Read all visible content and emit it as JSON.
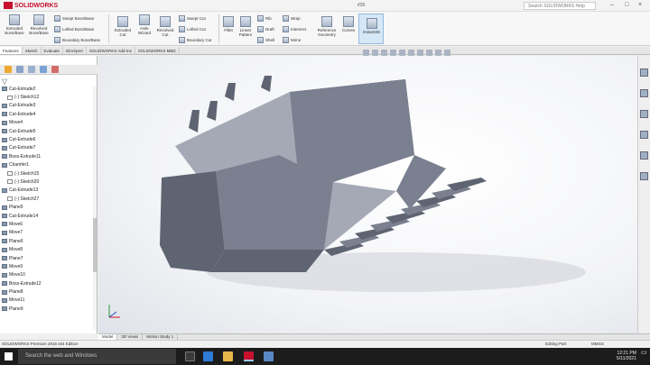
{
  "app": {
    "brand": "SOLIDWORKS",
    "title": "#20",
    "search_placeholder": "Search SOLIDWORKS Help"
  },
  "ribbon": {
    "buttons": [
      {
        "label": "Extruded Boss/Base"
      },
      {
        "label": "Revolved Boss/Base"
      },
      {
        "label": "Extruded Cut"
      },
      {
        "label": "Hole Wizard"
      },
      {
        "label": "Revolved Cut"
      },
      {
        "label": "Fillet"
      },
      {
        "label": "Linear Pattern"
      },
      {
        "label": "Reference Geometry"
      },
      {
        "label": "Curves"
      },
      {
        "label": "Instant3D"
      }
    ],
    "small": [
      {
        "label": "Swept Boss/Base"
      },
      {
        "label": "Lofted Boss/Base"
      },
      {
        "label": "Boundary Boss/Base"
      },
      {
        "label": "Swept Cut"
      },
      {
        "label": "Lofted Cut"
      },
      {
        "label": "Boundary Cut"
      },
      {
        "label": "Rib"
      },
      {
        "label": "Draft"
      },
      {
        "label": "Shell"
      },
      {
        "label": "Wrap"
      },
      {
        "label": "Intersect"
      },
      {
        "label": "Mirror"
      }
    ]
  },
  "command_tabs": [
    "Features",
    "Sketch",
    "Evaluate",
    "DimXpert",
    "SOLIDWORKS Add-Ins",
    "SOLIDWORKS MBD"
  ],
  "feature_tree": [
    {
      "label": "Cut-Extrude2",
      "sk": false,
      "indent": false
    },
    {
      "label": "(-) Sketch12",
      "sk": true,
      "indent": true
    },
    {
      "label": "Cut-Extrude3",
      "sk": false,
      "indent": false
    },
    {
      "label": "Cut-Extrude4",
      "sk": false,
      "indent": false
    },
    {
      "label": "Move4",
      "sk": false,
      "indent": false
    },
    {
      "label": "Cut-Extrude5",
      "sk": false,
      "indent": false
    },
    {
      "label": "Cut-Extrude6",
      "sk": false,
      "indent": false
    },
    {
      "label": "Cut-Extrude7",
      "sk": false,
      "indent": false
    },
    {
      "label": "Boss-Extrude11",
      "sk": false,
      "indent": false
    },
    {
      "label": "Chamfer1",
      "sk": false,
      "indent": false
    },
    {
      "label": "(-) Sketch15",
      "sk": true,
      "indent": true
    },
    {
      "label": "(-) Sketch20",
      "sk": true,
      "indent": true
    },
    {
      "label": "Cut-Extrude13",
      "sk": false,
      "indent": false
    },
    {
      "label": "(-) Sketch27",
      "sk": true,
      "indent": true
    },
    {
      "label": "Plane5",
      "sk": false,
      "indent": false
    },
    {
      "label": "Cut-Extrude14",
      "sk": false,
      "indent": false
    },
    {
      "label": "Move6",
      "sk": false,
      "indent": false
    },
    {
      "label": "Move7",
      "sk": false,
      "indent": false
    },
    {
      "label": "Plane6",
      "sk": false,
      "indent": false
    },
    {
      "label": "Move8",
      "sk": false,
      "indent": false
    },
    {
      "label": "Plane7",
      "sk": false,
      "indent": false
    },
    {
      "label": "Move9",
      "sk": false,
      "indent": false
    },
    {
      "label": "Move10",
      "sk": false,
      "indent": false
    },
    {
      "label": "Boss-Extrude12",
      "sk": false,
      "indent": false
    },
    {
      "label": "Plane8",
      "sk": false,
      "indent": false
    },
    {
      "label": "Move11",
      "sk": false,
      "indent": false
    },
    {
      "label": "Plane9",
      "sk": false,
      "indent": false
    }
  ],
  "bottom_tabs": [
    "Model",
    "3D Views",
    "Motion Study 1"
  ],
  "status": {
    "left": "SOLIDWORKS Premium 2016 x64 Edition",
    "mode": "Editing Part",
    "units": "MMGS"
  },
  "taskbar": {
    "search": "Search the web and Windows",
    "time": "12:21 PM",
    "date": "5/11/2021"
  },
  "colors": {
    "bucket_dark": "#5f6472",
    "bucket_mid": "#7b8090",
    "bucket_light": "#a5a9b6",
    "accent": "#c8102e"
  }
}
